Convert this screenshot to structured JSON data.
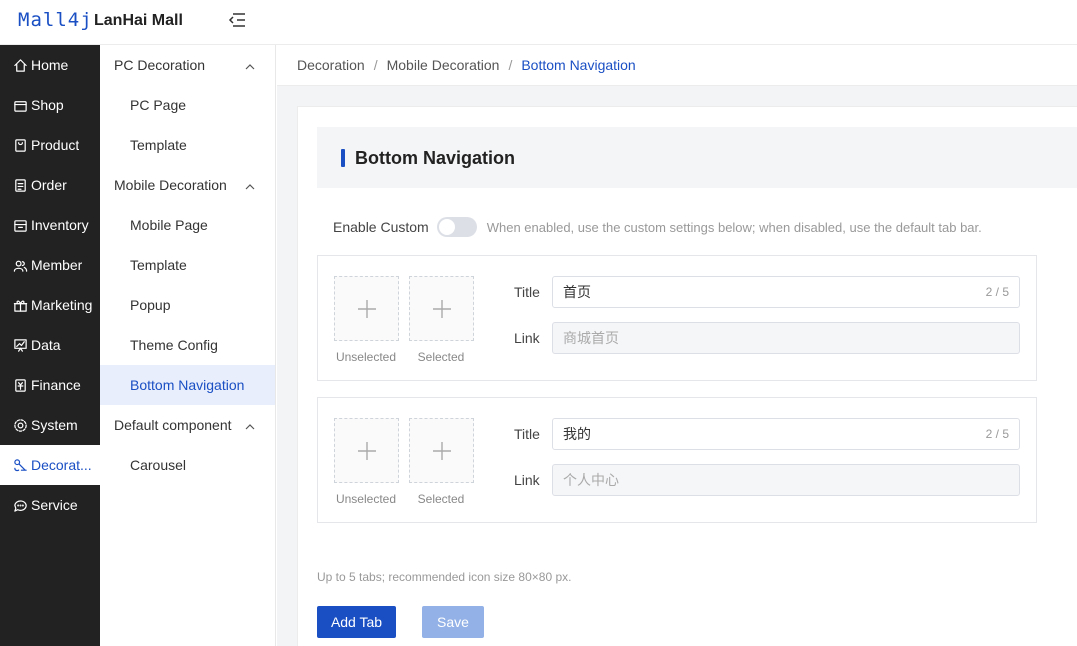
{
  "header": {
    "logo": "Mall4j",
    "mall_name": "LanHai Mall"
  },
  "sidebar": {
    "items": [
      {
        "label": "Home",
        "icon": "home-icon"
      },
      {
        "label": "Shop",
        "icon": "shop-icon"
      },
      {
        "label": "Product",
        "icon": "product-icon"
      },
      {
        "label": "Order",
        "icon": "order-icon"
      },
      {
        "label": "Inventory",
        "icon": "inventory-icon"
      },
      {
        "label": "Member",
        "icon": "member-icon"
      },
      {
        "label": "Marketing",
        "icon": "gift-icon"
      },
      {
        "label": "Data",
        "icon": "chart-icon"
      },
      {
        "label": "Finance",
        "icon": "finance-icon"
      },
      {
        "label": "System",
        "icon": "gear-icon"
      },
      {
        "label": "Decorat...",
        "icon": "brush-icon"
      },
      {
        "label": "Service",
        "icon": "chat-icon"
      }
    ],
    "active_index": 10
  },
  "submenu": {
    "groups": [
      {
        "label": "PC Decoration",
        "items": [
          "PC Page",
          "Template"
        ]
      },
      {
        "label": "Mobile Decoration",
        "items": [
          "Mobile Page",
          "Template",
          "Popup",
          "Theme Config",
          "Bottom Navigation"
        ]
      },
      {
        "label": "Default component",
        "items": [
          "Carousel"
        ]
      }
    ],
    "active_item": "Bottom Navigation"
  },
  "breadcrumb": {
    "items": [
      "Decoration",
      "Mobile Decoration"
    ],
    "current": "Bottom Navigation",
    "separator": "/"
  },
  "section": {
    "title": "Bottom Navigation"
  },
  "enable": {
    "label": "Enable Custom",
    "enabled": false,
    "hint": "When enabled, use the custom settings below; when disabled, use the default tab bar."
  },
  "tabs": [
    {
      "unselected_caption": "Unselected",
      "selected_caption": "Selected",
      "title_label": "Title",
      "title_value": "首页",
      "title_count": "2 / 5",
      "link_label": "Link",
      "link_value": "商城首页"
    },
    {
      "unselected_caption": "Unselected",
      "selected_caption": "Selected",
      "title_label": "Title",
      "title_value": "我的",
      "title_count": "2 / 5",
      "link_label": "Link",
      "link_value": "个人中心"
    }
  ],
  "footer": {
    "note": "Up to 5 tabs; recommended icon size 80×80 px.",
    "add_label": "Add Tab",
    "save_label": "Save"
  },
  "colors": {
    "primary": "#1a4fc4",
    "sidebar_bg": "#222222",
    "save_disabled": "#93b1e6"
  }
}
